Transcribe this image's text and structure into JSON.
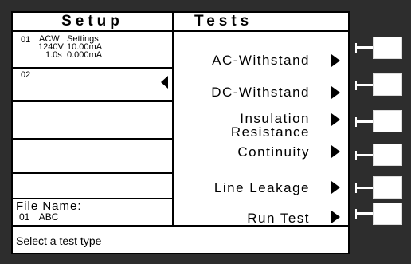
{
  "header": {
    "setup": "Setup",
    "tests": "Tests"
  },
  "slots": [
    {
      "number": "01",
      "mode": "ACW",
      "voltage": "1240V",
      "time": "1.0s",
      "settings_label": "Settings",
      "current_high": "10.00mA",
      "current_low": "0.000mA",
      "selected": false
    },
    {
      "number": "02",
      "selected": true
    },
    {
      "number": "",
      "selected": false
    },
    {
      "number": "",
      "selected": false
    },
    {
      "number": "",
      "selected": false
    }
  ],
  "file": {
    "label": "File Name:",
    "number": "01",
    "name": "ABC"
  },
  "tests": [
    {
      "label": "AC-Withstand"
    },
    {
      "label": "DC-Withstand"
    },
    {
      "label": "Insulation Resistance",
      "line1": "Insulation",
      "line2": "Resistance"
    },
    {
      "label": "Continuity"
    },
    {
      "label": "Line Leakage"
    },
    {
      "label": "Run Test"
    }
  ],
  "status": "Select a test type",
  "softkeys": [
    "softkey-1",
    "softkey-2",
    "softkey-3",
    "softkey-4",
    "softkey-5",
    "softkey-6"
  ]
}
